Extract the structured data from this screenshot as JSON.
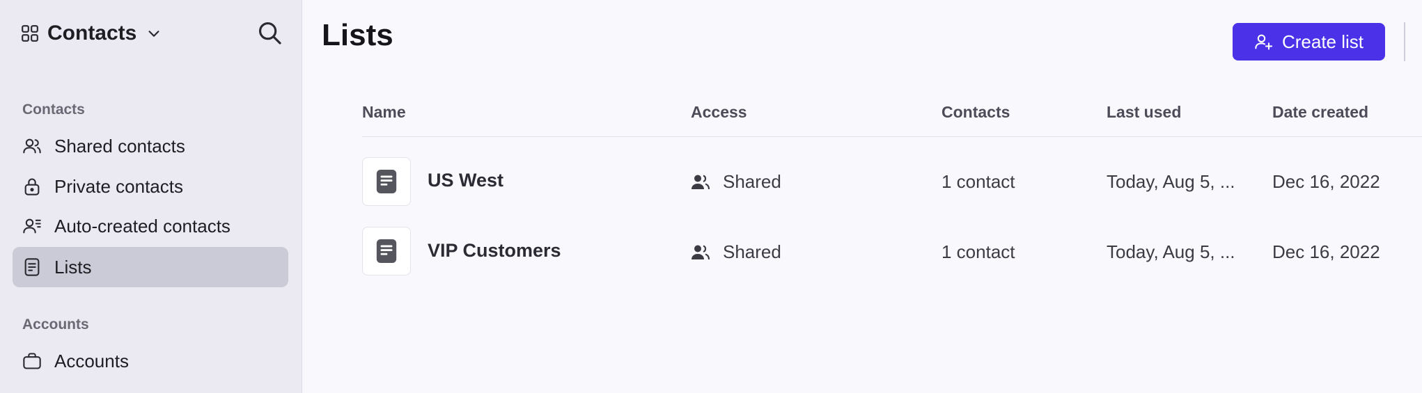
{
  "sidebar": {
    "app_title": "Contacts",
    "sections": [
      {
        "label": "Contacts",
        "items": [
          {
            "label": "Shared contacts",
            "icon": "users-icon"
          },
          {
            "label": "Private contacts",
            "icon": "lock-icon"
          },
          {
            "label": "Auto-created contacts",
            "icon": "user-list-icon"
          },
          {
            "label": "Lists",
            "icon": "document-icon",
            "active": true
          }
        ]
      },
      {
        "label": "Accounts",
        "items": [
          {
            "label": "Accounts",
            "icon": "briefcase-icon"
          }
        ]
      }
    ]
  },
  "main": {
    "title": "Lists",
    "create_button": "Create list",
    "accent_color": "#4b32e8",
    "columns": [
      "Name",
      "Access",
      "Contacts",
      "Last used",
      "Date created"
    ],
    "rows": [
      {
        "name": "US West",
        "access": "Shared",
        "contacts": "1 contact",
        "last_used": "Today, Aug 5, ...",
        "date_created": "Dec 16, 2022"
      },
      {
        "name": "VIP Customers",
        "access": "Shared",
        "contacts": "1 contact",
        "last_used": "Today, Aug 5, ...",
        "date_created": "Dec 16, 2022"
      }
    ]
  }
}
